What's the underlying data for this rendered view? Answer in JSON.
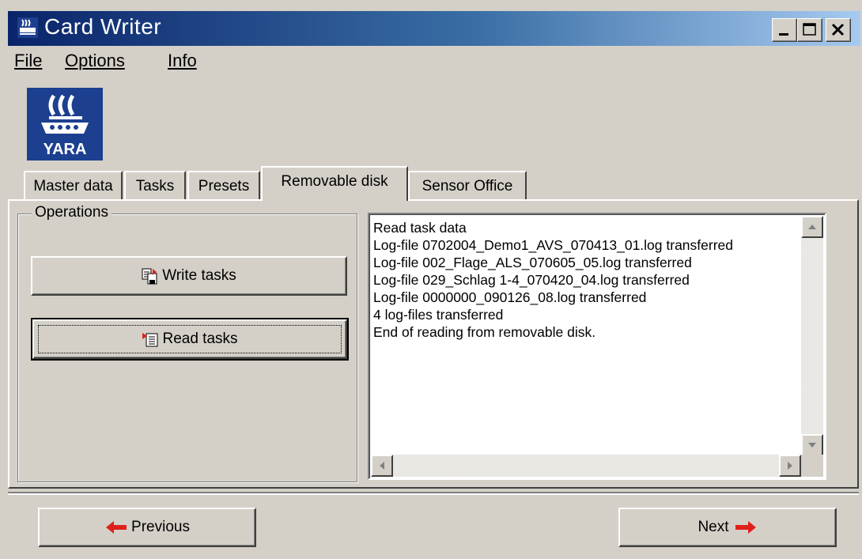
{
  "window": {
    "title": "Card Writer"
  },
  "menu": {
    "items": [
      "File",
      "Options",
      "Info"
    ]
  },
  "logo": {
    "text": "YARA",
    "color": "#1d3f8f"
  },
  "tabs": [
    {
      "label": "Master data",
      "active": false
    },
    {
      "label": "Tasks",
      "active": false
    },
    {
      "label": "Presets",
      "active": false
    },
    {
      "label": "Removable disk",
      "active": true
    },
    {
      "label": "Sensor Office",
      "active": false
    }
  ],
  "operations": {
    "legend": "Operations",
    "write_label": "Write tasks",
    "read_label": "Read tasks"
  },
  "log": {
    "lines": [
      "Read task data",
      "Log-file 0702004_Demo1_AVS_070413_01.log transferred",
      "Log-file 002_Flage_ALS_070605_05.log transferred",
      "Log-file 029_Schlag 1-4_070420_04.log transferred",
      "Log-file 0000000_090126_08.log transferred",
      "4 log-files transferred",
      "End of reading from removable disk."
    ]
  },
  "nav": {
    "previous_label": "Previous",
    "next_label": "Next"
  },
  "colors": {
    "titlebar_start": "#0a246a",
    "titlebar_end": "#a6caf0",
    "arrow": "#e0201a"
  }
}
